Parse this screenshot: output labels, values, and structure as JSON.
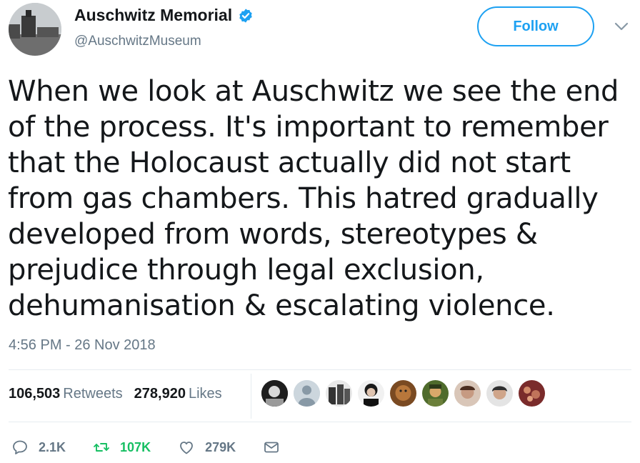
{
  "user": {
    "name": "Auschwitz Memorial",
    "handle": "@AuschwitzMuseum",
    "verified": true
  },
  "follow_label": "Follow",
  "tweet_text": "When we look at Auschwitz we see the end of the process. It's important to remember that the Holocaust actually did not start from gas chambers. This hatred gradually developed from words, stereotypes & prejudice through legal exclusion, dehumanisation & escalating violence.",
  "timestamp": "4:56 PM - 26 Nov 2018",
  "stats": {
    "retweets_count": "106,503",
    "retweets_label": "Retweets",
    "likes_count": "278,920",
    "likes_label": "Likes"
  },
  "actions": {
    "reply_count": "2.1K",
    "retweet_count": "107K",
    "like_count": "279K"
  },
  "colors": {
    "accent": "#1da1f2",
    "retweet": "#17bf63",
    "secondary_text": "#657786"
  }
}
